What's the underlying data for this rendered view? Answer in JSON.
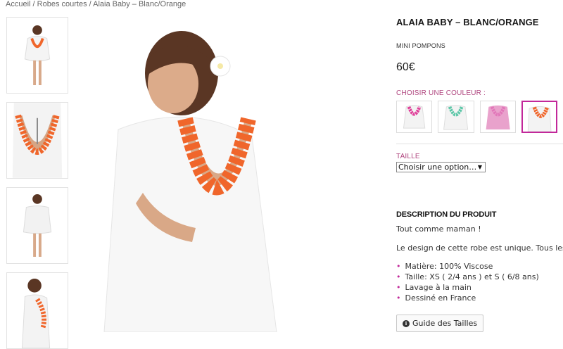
{
  "breadcrumb": {
    "home": "Accueil",
    "sep1": " / ",
    "category": "Robes courtes",
    "sep2": " / ",
    "current": "Alaia Baby – Blanc/Orange"
  },
  "product": {
    "title": "ALAIA BABY – BLANC/ORANGE",
    "subtitle": "MINI POMPONS",
    "price": "60€"
  },
  "color_picker": {
    "label": "CHOISIR UNE COULEUR :",
    "options": [
      {
        "name": "rose-fuchsia",
        "accent": "#e0409a",
        "selected": false
      },
      {
        "name": "menthe",
        "accent": "#5cc7a8",
        "selected": false
      },
      {
        "name": "rose",
        "accent": "#e277b9",
        "selected": false
      },
      {
        "name": "orange",
        "accent": "#f0662b",
        "selected": true
      }
    ]
  },
  "size_picker": {
    "label": "TAILLE",
    "selected": "Choisir une option…"
  },
  "description": {
    "title": "DESCRIPTION DU PRODUIT",
    "line1": "Tout comme maman !",
    "line2": "Le design de cette robe est unique. Tous les pomp",
    "specs": [
      "Matière: 100% Viscose",
      "Taille: XS ( 2/4 ans ) et S ( 6/8 ans)",
      "Lavage à la main",
      "Dessiné en France"
    ]
  },
  "guide_button": {
    "icon": "info-icon",
    "label": "Guide des Tailles"
  },
  "colors": {
    "accent_pink": "#c2289a",
    "label_pink": "#b0467f",
    "pompon_orange": "#f0662b"
  }
}
